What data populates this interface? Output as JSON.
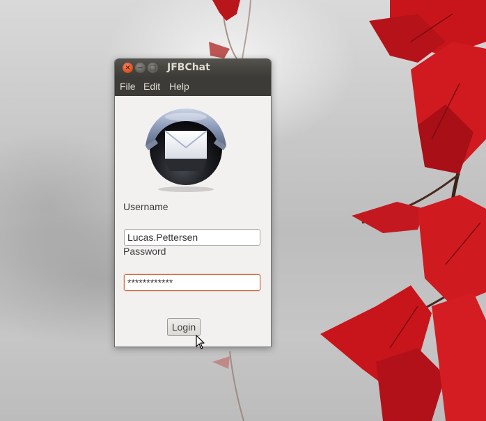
{
  "window": {
    "title": "JFBChat",
    "close_glyph": "×",
    "minimize_glyph": "−",
    "maximize_glyph": "□"
  },
  "menubar": {
    "items": [
      {
        "label": "File"
      },
      {
        "label": "Edit"
      },
      {
        "label": "Help"
      }
    ]
  },
  "login_form": {
    "logo_icon": "mail-envelope-icon",
    "username_label": "Username",
    "username_value": "Lucas.Pettersen",
    "password_label": "Password",
    "password_value": "************",
    "login_button_label": "Login"
  },
  "colors": {
    "titlebar": "#46443f",
    "menubar": "#3c3b37",
    "window_bg": "#f2f1f0",
    "focus_border": "#d46b3e",
    "close_button": "#e0541f",
    "leaf_red": "#c8151b"
  }
}
